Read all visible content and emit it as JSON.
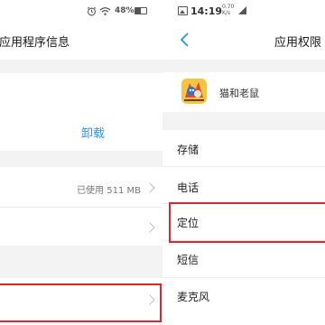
{
  "left": {
    "status": {
      "battery": "48%"
    },
    "title": "应用程序信息",
    "uninstall_label": "卸载",
    "storage_value": "已使用 511 MB"
  },
  "right": {
    "status": {
      "time": "14:19",
      "speed": "0.70\nK/s"
    },
    "title": "应用权限",
    "app_name": "猫和老鼠",
    "permissions": [
      {
        "label": "存储"
      },
      {
        "label": "电话"
      },
      {
        "label": "定位"
      },
      {
        "label": "短信"
      },
      {
        "label": "麦克风"
      }
    ]
  },
  "colors": {
    "accent": "#2196f3",
    "highlight": "#e0262b",
    "gap": "#f3f3f3"
  }
}
